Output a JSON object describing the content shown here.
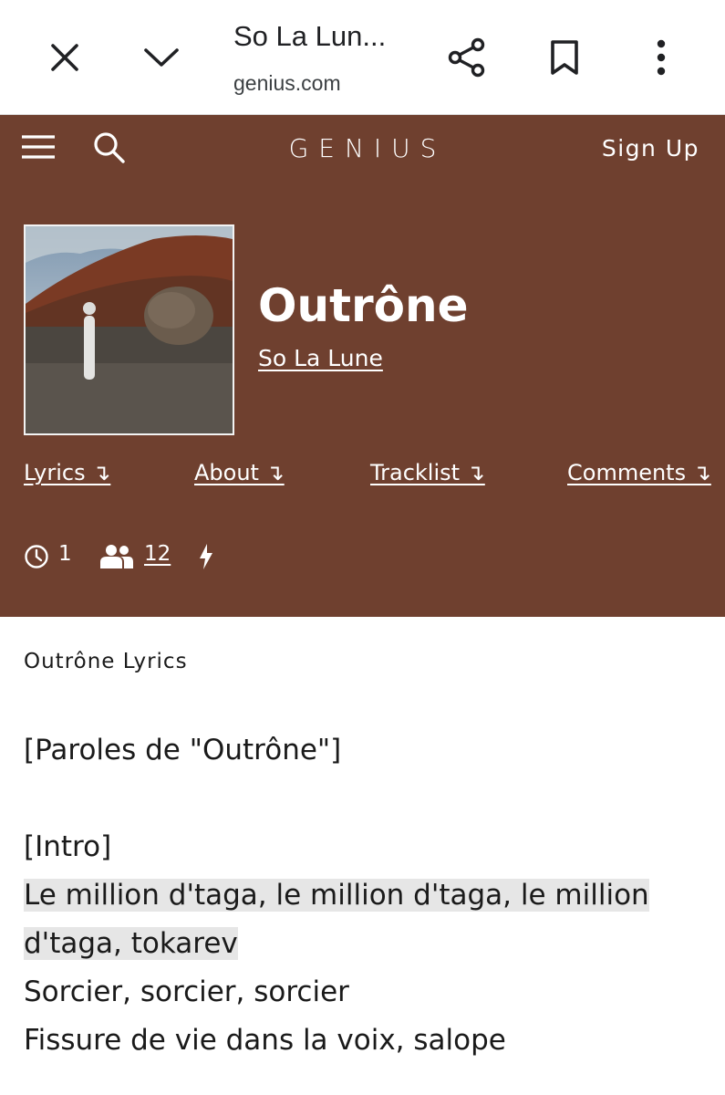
{
  "browser": {
    "tab_title": "So La Lun...",
    "domain": "genius.com",
    "icons": [
      "close-icon",
      "chevron-down-icon",
      "share-icon",
      "bookmark-icon",
      "more-vertical-icon"
    ]
  },
  "genius_header": {
    "logo": "GENIUS",
    "signup_label": "Sign Up",
    "bg_color": "#6f402f",
    "icons": [
      "menu-icon",
      "search-icon"
    ]
  },
  "song": {
    "title": "Outrône",
    "artist": "So La Lune"
  },
  "nav": {
    "lyrics": "Lyrics ↴",
    "about": "About ↴",
    "tracklist": "Tracklist ↴",
    "comments": "Comments ↴"
  },
  "stats": {
    "pageviews_icon": "clock-icon",
    "pageviews": "1",
    "contributors_icon": "people-icon",
    "contributors": "12",
    "hot_icon": "bolt-icon"
  },
  "lyrics": {
    "heading": "Outrône Lyrics",
    "lines": [
      "[Paroles de \"Outrône\"]",
      "",
      "[Intro]",
      "Le million d'taga, le million d'taga, le million d'taga, tokarev",
      "Sorcier, sorcier, sorcier",
      "Fissure de vie dans la voix, salope"
    ],
    "highlighted_line_index": 3,
    "highlight_color": "#e6e6e6"
  }
}
